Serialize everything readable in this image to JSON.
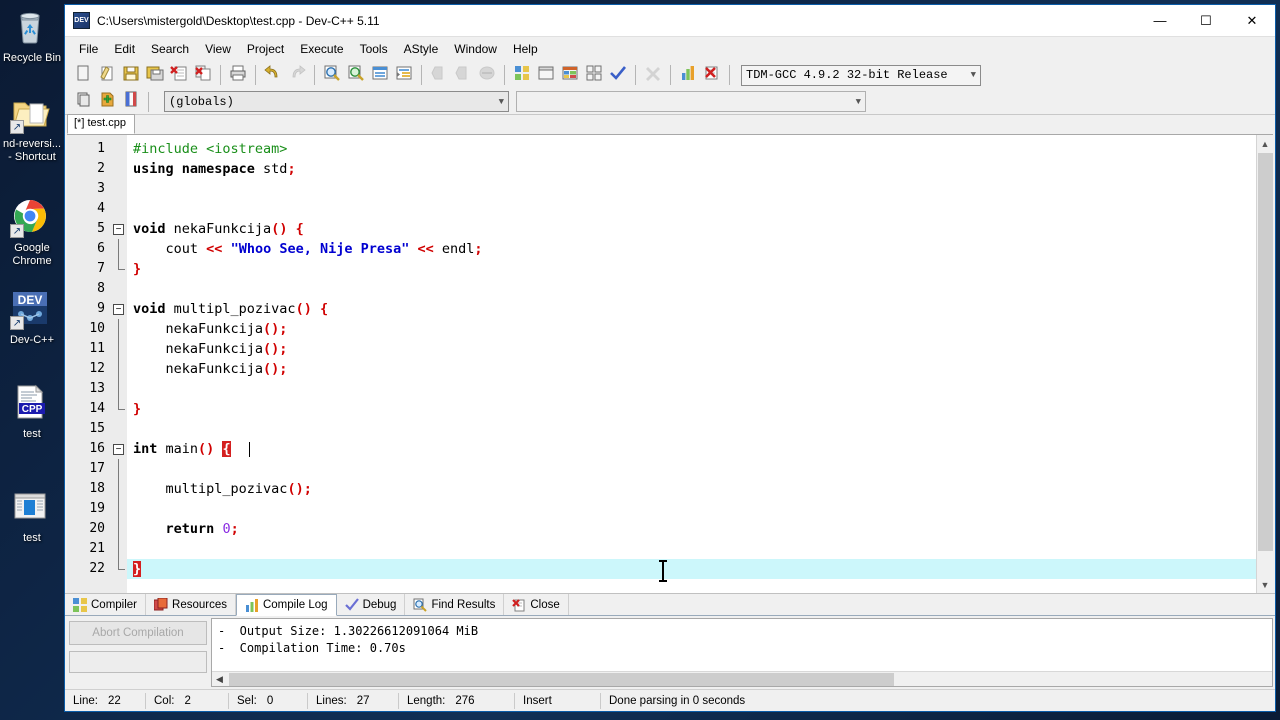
{
  "desktop": {
    "icons": [
      {
        "name": "recycle-bin",
        "label": "Recycle Bin",
        "shortcut": false
      },
      {
        "name": "folder-shortcut",
        "label": "nd-reversi...\n- Shortcut",
        "shortcut": true
      },
      {
        "name": "google-chrome",
        "label": "Google\nChrome",
        "shortcut": true
      },
      {
        "name": "dev-cpp",
        "label": "Dev-C++",
        "shortcut": true
      },
      {
        "name": "test-cpp-file",
        "label": "test",
        "shortcut": false
      },
      {
        "name": "test-exe",
        "label": "test",
        "shortcut": false
      }
    ]
  },
  "window": {
    "title": "C:\\Users\\mistergold\\Desktop\\test.cpp - Dev-C++ 5.11",
    "app_icon": "dev-cpp-icon",
    "minimize": "—",
    "maximize": "☐",
    "close": "✕"
  },
  "menubar": {
    "items": [
      {
        "label": "File"
      },
      {
        "label": "Edit"
      },
      {
        "label": "Search"
      },
      {
        "label": "View"
      },
      {
        "label": "Project"
      },
      {
        "label": "Execute"
      },
      {
        "label": "Tools"
      },
      {
        "label": "AStyle"
      },
      {
        "label": "Window"
      },
      {
        "label": "Help"
      }
    ]
  },
  "toolbar": {
    "row1": [
      {
        "name": "new-file-button",
        "icon": "new-file-icon",
        "disabled": false
      },
      {
        "name": "open-file-button",
        "icon": "open-file-icon",
        "disabled": false
      },
      {
        "name": "save-button",
        "icon": "save-icon",
        "disabled": false
      },
      {
        "name": "save-all-button",
        "icon": "save-all-icon",
        "disabled": false
      },
      {
        "name": "close-file-button",
        "icon": "close-file-icon",
        "disabled": false
      },
      {
        "name": "close-all-button",
        "icon": "close-all-icon",
        "disabled": false
      },
      {
        "sep": true
      },
      {
        "name": "print-button",
        "icon": "print-icon",
        "disabled": false
      },
      {
        "sep": true
      },
      {
        "name": "undo-button",
        "icon": "undo-icon",
        "disabled": false
      },
      {
        "name": "redo-button",
        "icon": "redo-icon",
        "disabled": true
      },
      {
        "sep": true
      },
      {
        "name": "find-button",
        "icon": "find-icon",
        "disabled": false
      },
      {
        "name": "replace-button",
        "icon": "replace-icon",
        "disabled": false
      },
      {
        "name": "goto-line-button",
        "icon": "goto-line-icon",
        "disabled": false
      },
      {
        "name": "indent-button",
        "icon": "indent-icon",
        "disabled": false
      },
      {
        "sep": true
      },
      {
        "name": "back-button",
        "icon": "back-icon",
        "disabled": true
      },
      {
        "name": "forward-button",
        "icon": "forward-icon",
        "disabled": true
      },
      {
        "name": "toggle-button",
        "icon": "toggle-icon",
        "disabled": true
      },
      {
        "sep": true
      },
      {
        "name": "compile-button",
        "icon": "compile-icon",
        "disabled": false
      },
      {
        "name": "run-button",
        "icon": "run-icon",
        "disabled": false
      },
      {
        "name": "compile-run-button",
        "icon": "compile-run-icon",
        "disabled": false
      },
      {
        "name": "rebuild-all-button",
        "icon": "rebuild-all-icon",
        "disabled": false
      },
      {
        "name": "syntax-check-button",
        "icon": "check-icon",
        "disabled": false
      },
      {
        "sep": true
      },
      {
        "name": "stop-button",
        "icon": "stop-icon",
        "disabled": true
      },
      {
        "sep": true
      },
      {
        "name": "profile-button",
        "icon": "profile-icon",
        "disabled": false
      },
      {
        "name": "debug-button",
        "icon": "debug-icon",
        "disabled": false
      }
    ],
    "compiler_select": {
      "name": "compiler-select",
      "value": "TDM-GCC 4.9.2 32-bit Release"
    },
    "row2": [
      {
        "name": "new-project-button",
        "icon": "new-project-icon"
      },
      {
        "name": "add-to-project-button",
        "icon": "add-to-project-icon"
      },
      {
        "name": "project-options-button",
        "icon": "project-options-icon"
      }
    ],
    "globals_select": {
      "name": "globals-select",
      "value": "(globals)"
    },
    "scope_select": {
      "name": "scope-select",
      "value": ""
    }
  },
  "editor": {
    "tab_label": "[*] test.cpp",
    "lines": [
      {
        "n": 1,
        "fold": "start-none",
        "tokens": [
          {
            "t": "#include ",
            "c": "pre"
          },
          {
            "t": "<iostream>",
            "c": "pre"
          }
        ]
      },
      {
        "n": 2,
        "tokens": [
          {
            "t": "using namespace",
            "c": "kw"
          },
          {
            "t": " std",
            "c": "pln"
          },
          {
            "t": ";",
            "c": "sym"
          }
        ]
      },
      {
        "n": 3,
        "tokens": []
      },
      {
        "n": 4,
        "tokens": []
      },
      {
        "n": 5,
        "fold": "open",
        "tokens": [
          {
            "t": "void",
            "c": "kw"
          },
          {
            "t": " nekaFunkcija",
            "c": "pln"
          },
          {
            "t": "()",
            "c": "sym"
          },
          {
            "t": " ",
            "c": "pln"
          },
          {
            "t": "{",
            "c": "sym"
          }
        ]
      },
      {
        "n": 6,
        "fold": "bar",
        "tokens": [
          {
            "t": "    cout ",
            "c": "pln"
          },
          {
            "t": "<<",
            "c": "sym"
          },
          {
            "t": " ",
            "c": "pln"
          },
          {
            "t": "\"Whoo See, Nije Presa\"",
            "c": "str"
          },
          {
            "t": " ",
            "c": "pln"
          },
          {
            "t": "<<",
            "c": "sym"
          },
          {
            "t": " endl",
            "c": "pln"
          },
          {
            "t": ";",
            "c": "sym"
          }
        ]
      },
      {
        "n": 7,
        "fold": "close",
        "tokens": [
          {
            "t": "}",
            "c": "sym"
          }
        ]
      },
      {
        "n": 8,
        "tokens": []
      },
      {
        "n": 9,
        "fold": "open",
        "tokens": [
          {
            "t": "void",
            "c": "kw"
          },
          {
            "t": " multipl_pozivac",
            "c": "pln"
          },
          {
            "t": "()",
            "c": "sym"
          },
          {
            "t": " ",
            "c": "pln"
          },
          {
            "t": "{",
            "c": "sym"
          }
        ]
      },
      {
        "n": 10,
        "fold": "bar",
        "tokens": [
          {
            "t": "    nekaFunkcija",
            "c": "pln"
          },
          {
            "t": "();",
            "c": "sym"
          }
        ]
      },
      {
        "n": 11,
        "fold": "bar",
        "tokens": [
          {
            "t": "    nekaFunkcija",
            "c": "pln"
          },
          {
            "t": "();",
            "c": "sym"
          }
        ]
      },
      {
        "n": 12,
        "fold": "bar",
        "tokens": [
          {
            "t": "    nekaFunkcija",
            "c": "pln"
          },
          {
            "t": "();",
            "c": "sym"
          }
        ]
      },
      {
        "n": 13,
        "fold": "bar",
        "tokens": []
      },
      {
        "n": 14,
        "fold": "close",
        "tokens": [
          {
            "t": "}",
            "c": "sym"
          }
        ]
      },
      {
        "n": 15,
        "tokens": []
      },
      {
        "n": 16,
        "fold": "open",
        "tokens": [
          {
            "t": "int",
            "c": "kw"
          },
          {
            "t": " main",
            "c": "pln"
          },
          {
            "t": "()",
            "c": "sym"
          },
          {
            "t": " ",
            "c": "pln"
          },
          {
            "t": "{",
            "c": "brk-hl"
          }
        ]
      },
      {
        "n": 17,
        "fold": "bar",
        "tokens": []
      },
      {
        "n": 18,
        "fold": "bar",
        "tokens": [
          {
            "t": "    multipl_pozivac",
            "c": "pln"
          },
          {
            "t": "();",
            "c": "sym"
          }
        ]
      },
      {
        "n": 19,
        "fold": "bar",
        "tokens": []
      },
      {
        "n": 20,
        "fold": "bar",
        "tokens": [
          {
            "t": "    ",
            "c": "pln"
          },
          {
            "t": "return",
            "c": "kw"
          },
          {
            "t": " ",
            "c": "pln"
          },
          {
            "t": "0",
            "c": "num"
          },
          {
            "t": ";",
            "c": "sym"
          }
        ]
      },
      {
        "n": 21,
        "fold": "bar",
        "tokens": []
      },
      {
        "n": 22,
        "fold": "close",
        "current": true,
        "tokens": [
          {
            "t": "}",
            "c": "brk-hl"
          }
        ]
      }
    ]
  },
  "bottom_panel": {
    "tabs": [
      {
        "name": "tab-compiler",
        "label": "Compiler",
        "icon": "compiler-icon",
        "active": false
      },
      {
        "name": "tab-resources",
        "label": "Resources",
        "icon": "resources-icon",
        "active": false
      },
      {
        "name": "tab-compile-log",
        "label": "Compile Log",
        "icon": "compile-log-icon",
        "active": true
      },
      {
        "name": "tab-debug",
        "label": "Debug",
        "icon": "debug-tab-icon",
        "active": false
      },
      {
        "name": "tab-find-results",
        "label": "Find Results",
        "icon": "find-results-icon",
        "active": false
      },
      {
        "name": "tab-close",
        "label": "Close",
        "icon": "close-panel-icon",
        "active": false
      }
    ],
    "abort_button": "Abort Compilation",
    "log_lines": [
      "-  Output Size: 1.30226612091064 MiB",
      "-  Compilation Time: 0.70s"
    ]
  },
  "statusbar": {
    "line_label": "Line:",
    "line_value": "22",
    "col_label": "Col:",
    "col_value": "2",
    "sel_label": "Sel:",
    "sel_value": "0",
    "lines_label": "Lines:",
    "lines_value": "27",
    "len_label": "Length:",
    "len_value": "276",
    "mode": "Insert",
    "message": "Done parsing in 0 seconds"
  },
  "colors": {
    "accent": "#0a5ca8",
    "current_line": "#ccf7fb",
    "bracket_match": "#d42020",
    "keyword": "#000000",
    "preprocessor": "#1a8f1a",
    "string": "#0000d0",
    "symbol": "#d00000"
  }
}
